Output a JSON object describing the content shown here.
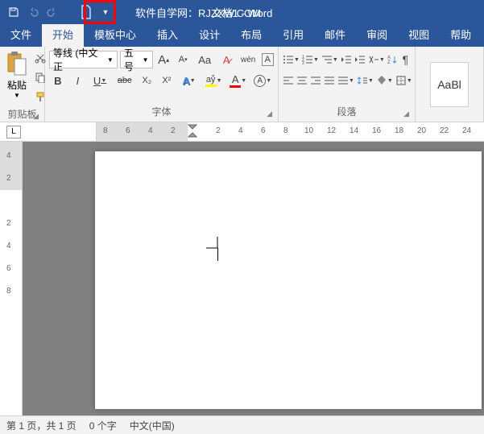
{
  "title": "文档1 - Word",
  "watermark": "软件自学网：RJZXW.COM",
  "menu": {
    "file": "文件",
    "home": "开始",
    "templates": "模板中心",
    "insert": "插入",
    "design": "设计",
    "layout": "布局",
    "references": "引用",
    "mailings": "邮件",
    "review": "审阅",
    "view": "视图",
    "help": "帮助"
  },
  "clipboard": {
    "paste": "粘贴",
    "label": "剪贴板"
  },
  "font": {
    "name": "等线 (中文正",
    "size": "五号",
    "label": "字体",
    "aa": "Aa",
    "wen": "wén",
    "btns": {
      "bold": "B",
      "italic": "I",
      "underline": "U",
      "abc": "abc",
      "x2": "X₂",
      "x2sup": "X²",
      "a_outline": "A",
      "highlight": "aẙ",
      "a_color": "A",
      "a_circle": "A"
    }
  },
  "paragraph": {
    "label": "段落"
  },
  "styles": {
    "sample": "AaBl"
  },
  "ruler": {
    "left_label": "L",
    "nums_left": [
      "8",
      "6",
      "4",
      "2"
    ],
    "nums_right": [
      "2",
      "4",
      "6",
      "8",
      "10",
      "12",
      "14",
      "16",
      "18",
      "20",
      "22",
      "24"
    ]
  },
  "vruler": {
    "nums": [
      "4",
      "2",
      "2",
      "4",
      "6",
      "8"
    ]
  },
  "status": {
    "page": "第 1 页，共 1 页",
    "words": "0 个字",
    "lang": "中文(中国)"
  }
}
